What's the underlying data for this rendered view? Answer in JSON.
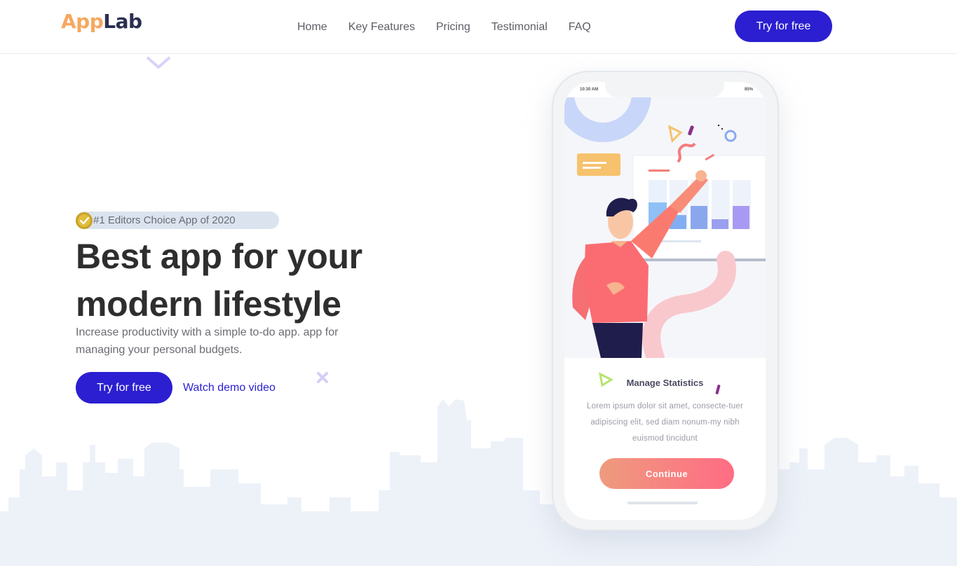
{
  "header": {
    "logo_part1": "App",
    "logo_part2": "Lab",
    "nav": [
      "Home",
      "Key Features",
      "Pricing",
      "Testimonial",
      "FAQ"
    ],
    "cta_label": "Try for free"
  },
  "hero": {
    "badge_text": "#1 Editors Choice App of 2020",
    "title_line1": "Best app for your",
    "title_line2": "modern lifestyle",
    "subtitle": "Increase productivity with a simple to-do app. app for managing your personal budgets.",
    "cta_label": "Try for free",
    "demo_label": "Watch demo video"
  },
  "phone": {
    "status_time": "10:30 AM",
    "status_battery": "85%",
    "card_title": "Manage Statistics",
    "card_body": "Lorem ipsum dolor sit amet, consecte-tuer adipiscing elit, sed diam nonum-my nibh euismod tincidunt",
    "continue_label": "Continue"
  },
  "colors": {
    "brand_primary": "#2b1fd1",
    "logo_orange": "#f6a85f",
    "logo_navy": "#2a2f52",
    "continue_gradient_start": "#ee9b7e",
    "continue_gradient_end": "#ff6c84"
  },
  "icons": {
    "badge": "verified-check-icon",
    "decor_diamond": "diamond-outline-icon",
    "decor_x": "cross-icon"
  }
}
